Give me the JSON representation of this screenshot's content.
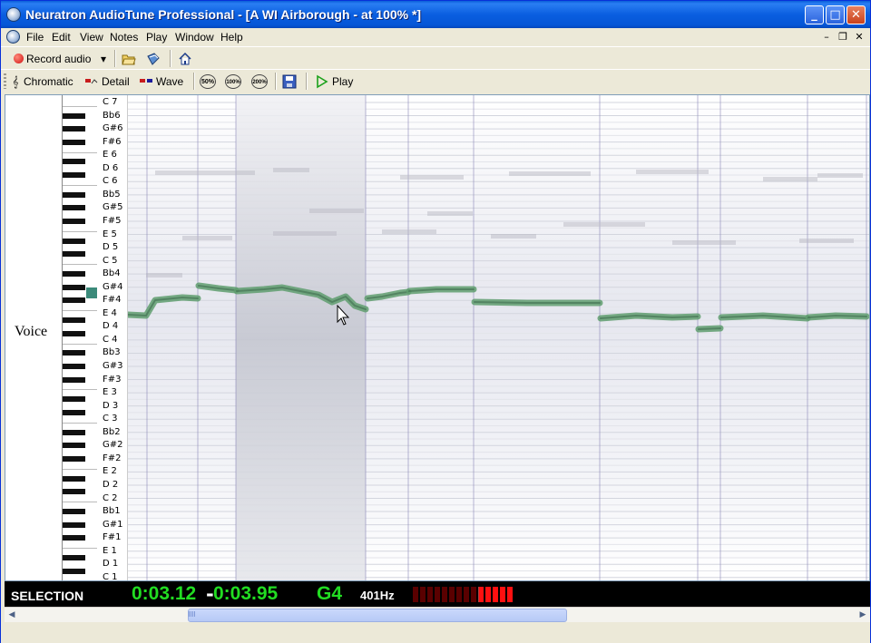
{
  "window": {
    "title": "Neuratron AudioTune Professional - [A WI Airborough - at 100% *]",
    "minimize": "_",
    "maximize": "□",
    "close": "✕"
  },
  "menu": [
    "File",
    "Edit",
    "View",
    "Notes",
    "Play",
    "Window",
    "Help"
  ],
  "mdi": {
    "minimize": "–",
    "restore": "❐",
    "close": "✕"
  },
  "toolbar1": {
    "record_label": "Record audio",
    "record_dropdown": "▾"
  },
  "toolbar2": {
    "chromatic": "Chromatic",
    "detail": "Detail",
    "wave": "Wave",
    "zoom50": "50%",
    "zoom100": "100%",
    "zoom200": "200%",
    "play": "Play"
  },
  "track": {
    "name": "Voice"
  },
  "notes": [
    "C 7",
    "Bb6",
    "G#6",
    "F#6",
    "E 6",
    "D 6",
    "C 6",
    "Bb5",
    "G#5",
    "F#5",
    "E 5",
    "D 5",
    "C 5",
    "Bb4",
    "G#4",
    "F#4",
    "E 4",
    "D 4",
    "C 4",
    "Bb3",
    "G#3",
    "F#3",
    "E 3",
    "D 3",
    "C 3",
    "Bb2",
    "G#2",
    "F#2",
    "E 2",
    "D 2",
    "C 2",
    "Bb1",
    "G#1",
    "F#1",
    "E 1",
    "D 1",
    "C 1"
  ],
  "status": {
    "label": "SELECTION",
    "start": "0:03.12",
    "dash": "-",
    "end": "0:03.95",
    "note": "G4",
    "hz": "401Hz",
    "meter_lit_fraction": 0.36
  },
  "colors": {
    "pitch": "#5f9e6e",
    "selection": "#c8cad4",
    "meter_on": "#ff1010",
    "meter_off": "#5a0000"
  }
}
